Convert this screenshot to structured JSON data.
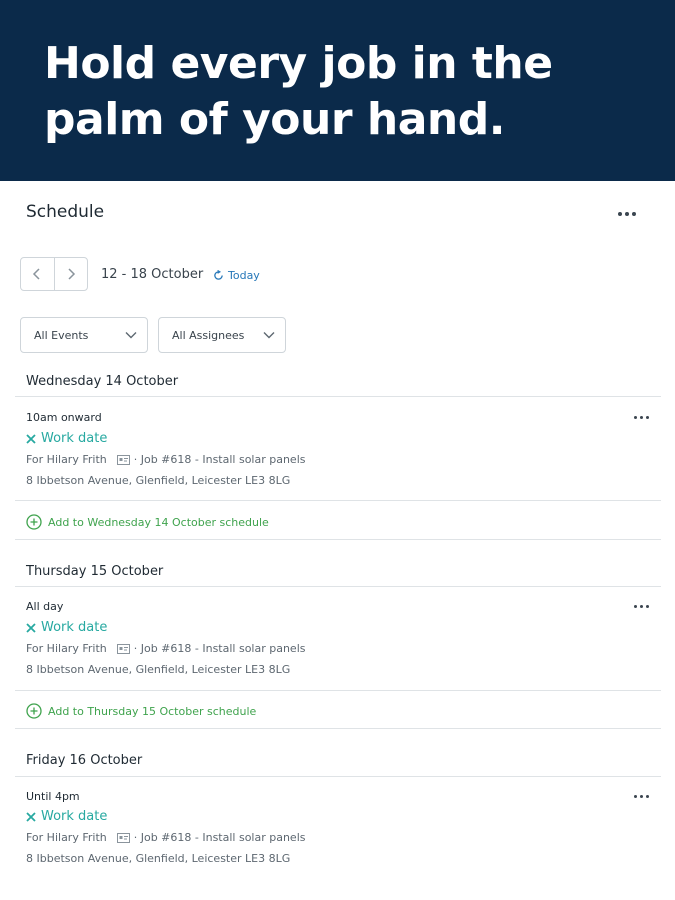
{
  "hero": {
    "title": "Hold every job in the palm of your hand."
  },
  "schedule": {
    "title": "Schedule",
    "date_range": "12 - 18 October",
    "today_label": "Today",
    "filters": {
      "events": "All Events",
      "assignees": "All Assignees"
    }
  },
  "days": [
    {
      "heading": "Wednesday 14 October",
      "time": "10am onward",
      "type": "Work date",
      "client": "For Hilary Frith",
      "job": "· Job #618 - Install solar panels",
      "address": "8 Ibbetson Avenue, Glenfield, Leicester LE3 8LG",
      "add_label": "Add to Wednesday 14 October schedule"
    },
    {
      "heading": "Thursday 15 October",
      "time": "All day",
      "type": "Work date",
      "client": "For Hilary Frith",
      "job": "· Job #618 - Install solar panels",
      "address": "8 Ibbetson Avenue, Glenfield, Leicester LE3 8LG",
      "add_label": "Add to Thursday 15 October schedule"
    },
    {
      "heading": "Friday 16 October",
      "time": "Until 4pm",
      "type": "Work date",
      "client": "For Hilary Frith",
      "job": "· Job #618 - Install solar panels",
      "address": "8 Ibbetson Avenue, Glenfield, Leicester LE3 8LG"
    }
  ],
  "icons": {
    "more": "more-options-icon",
    "prev": "chevron-left-icon",
    "next": "chevron-right-icon",
    "today": "refresh-icon",
    "dropdown": "chevron-down-icon",
    "work": "tools-icon",
    "client": "client-card-icon",
    "add": "plus-circle-icon"
  },
  "colors": {
    "hero_bg": "#0b2a4a",
    "work_type": "#27a9a1",
    "add_link": "#3fa34d",
    "today_link": "#2677b8"
  }
}
